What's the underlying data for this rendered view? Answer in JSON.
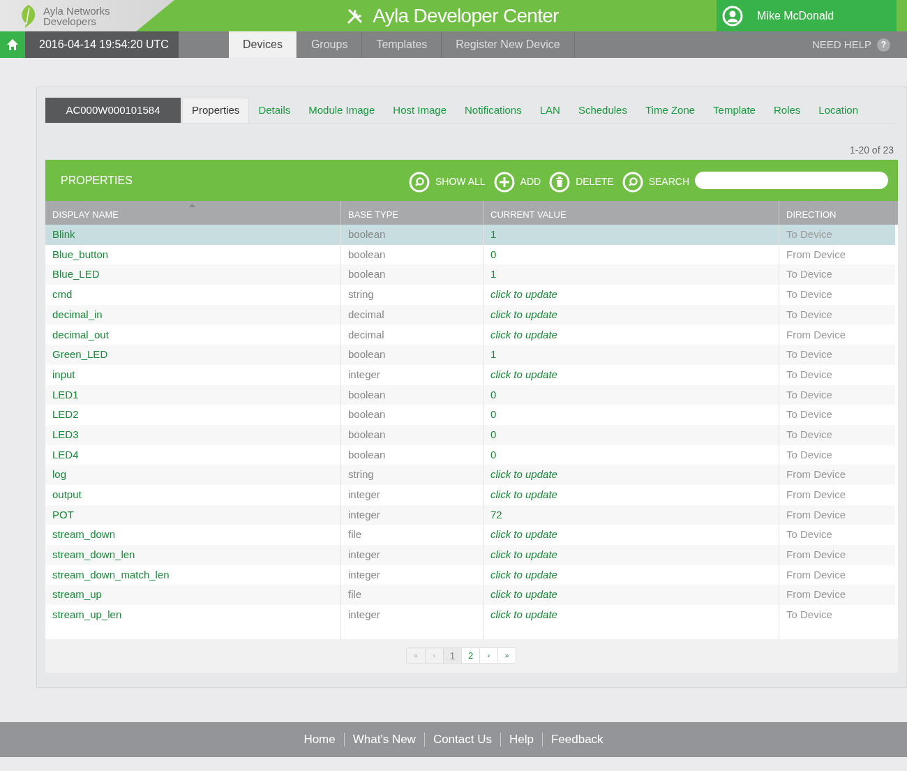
{
  "brand": {
    "line1": "Ayla Networks",
    "line2": "Developers"
  },
  "app_title": "Ayla Developer Center",
  "user": {
    "name": "Mike McDonald"
  },
  "clock": "2016-04-14 19:54:20 UTC",
  "nav": [
    {
      "label": "Devices",
      "selected": true
    },
    {
      "label": "Groups",
      "selected": false
    },
    {
      "label": "Templates",
      "selected": false
    },
    {
      "label": "Register New Device",
      "selected": false
    }
  ],
  "help": {
    "label": "NEED HELP",
    "icon": "?"
  },
  "device_id": "AC000W000101584",
  "device_tabs": [
    {
      "label": "Properties",
      "selected": true
    },
    {
      "label": "Details",
      "selected": false
    },
    {
      "label": "Module Image",
      "selected": false
    },
    {
      "label": "Host Image",
      "selected": false
    },
    {
      "label": "Notifications",
      "selected": false
    },
    {
      "label": "LAN",
      "selected": false
    },
    {
      "label": "Schedules",
      "selected": false
    },
    {
      "label": "Time Zone",
      "selected": false
    },
    {
      "label": "Template",
      "selected": false
    },
    {
      "label": "Roles",
      "selected": false
    },
    {
      "label": "Location",
      "selected": false
    }
  ],
  "range": "1-20 of 23",
  "panel": {
    "title": "PROPERTIES",
    "actions": [
      {
        "kind": "search",
        "label": "SHOW ALL"
      },
      {
        "kind": "add",
        "label": "ADD"
      },
      {
        "kind": "delete",
        "label": "DELETE"
      },
      {
        "kind": "search",
        "label": "SEARCH"
      }
    ]
  },
  "table": {
    "columns": [
      "DISPLAY NAME",
      "BASE TYPE",
      "CURRENT VALUE",
      "DIRECTION"
    ],
    "rows": [
      {
        "name": "Blink",
        "type": "boolean",
        "value": "1",
        "kind": "value",
        "direction": "To Device",
        "selected": true
      },
      {
        "name": "Blue_button",
        "type": "boolean",
        "value": "0",
        "kind": "value",
        "direction": "From Device",
        "selected": false
      },
      {
        "name": "Blue_LED",
        "type": "boolean",
        "value": "1",
        "kind": "value",
        "direction": "To Device",
        "selected": false
      },
      {
        "name": "cmd",
        "type": "string",
        "value": "click to update",
        "kind": "prompt",
        "direction": "To Device",
        "selected": false
      },
      {
        "name": "decimal_in",
        "type": "decimal",
        "value": "click to update",
        "kind": "prompt",
        "direction": "To Device",
        "selected": false
      },
      {
        "name": "decimal_out",
        "type": "decimal",
        "value": "click to update",
        "kind": "prompt",
        "direction": "From Device",
        "selected": false
      },
      {
        "name": "Green_LED",
        "type": "boolean",
        "value": "1",
        "kind": "value",
        "direction": "To Device",
        "selected": false
      },
      {
        "name": "input",
        "type": "integer",
        "value": "click to update",
        "kind": "prompt",
        "direction": "To Device",
        "selected": false
      },
      {
        "name": "LED1",
        "type": "boolean",
        "value": "0",
        "kind": "value",
        "direction": "To Device",
        "selected": false
      },
      {
        "name": "LED2",
        "type": "boolean",
        "value": "0",
        "kind": "value",
        "direction": "To Device",
        "selected": false
      },
      {
        "name": "LED3",
        "type": "boolean",
        "value": "0",
        "kind": "value",
        "direction": "To Device",
        "selected": false
      },
      {
        "name": "LED4",
        "type": "boolean",
        "value": "0",
        "kind": "value",
        "direction": "To Device",
        "selected": false
      },
      {
        "name": "log",
        "type": "string",
        "value": "click to update",
        "kind": "prompt",
        "direction": "From Device",
        "selected": false
      },
      {
        "name": "output",
        "type": "integer",
        "value": "click to update",
        "kind": "prompt",
        "direction": "From Device",
        "selected": false
      },
      {
        "name": "POT",
        "type": "integer",
        "value": "72",
        "kind": "value",
        "direction": "From Device",
        "selected": false
      },
      {
        "name": "stream_down",
        "type": "file",
        "value": "click to update",
        "kind": "prompt",
        "direction": "To Device",
        "selected": false
      },
      {
        "name": "stream_down_len",
        "type": "integer",
        "value": "click to update",
        "kind": "prompt",
        "direction": "From Device",
        "selected": false
      },
      {
        "name": "stream_down_match_len",
        "type": "integer",
        "value": "click to update",
        "kind": "prompt",
        "direction": "From Device",
        "selected": false
      },
      {
        "name": "stream_up",
        "type": "file",
        "value": "click to update",
        "kind": "prompt",
        "direction": "From Device",
        "selected": false
      },
      {
        "name": "stream_up_len",
        "type": "integer",
        "value": "click to update",
        "kind": "prompt",
        "direction": "To Device",
        "selected": false
      }
    ]
  },
  "pagination": [
    {
      "label": "«",
      "selected": false,
      "disabled": true
    },
    {
      "label": "‹",
      "selected": false,
      "disabled": true
    },
    {
      "label": "1",
      "selected": true,
      "disabled": false
    },
    {
      "label": "2",
      "selected": false,
      "disabled": false
    },
    {
      "label": "›",
      "selected": false,
      "disabled": false
    },
    {
      "label": "»",
      "selected": false,
      "disabled": false
    }
  ],
  "footer": [
    "Home",
    "What's New",
    "Contact Us",
    "Help",
    "Feedback"
  ]
}
